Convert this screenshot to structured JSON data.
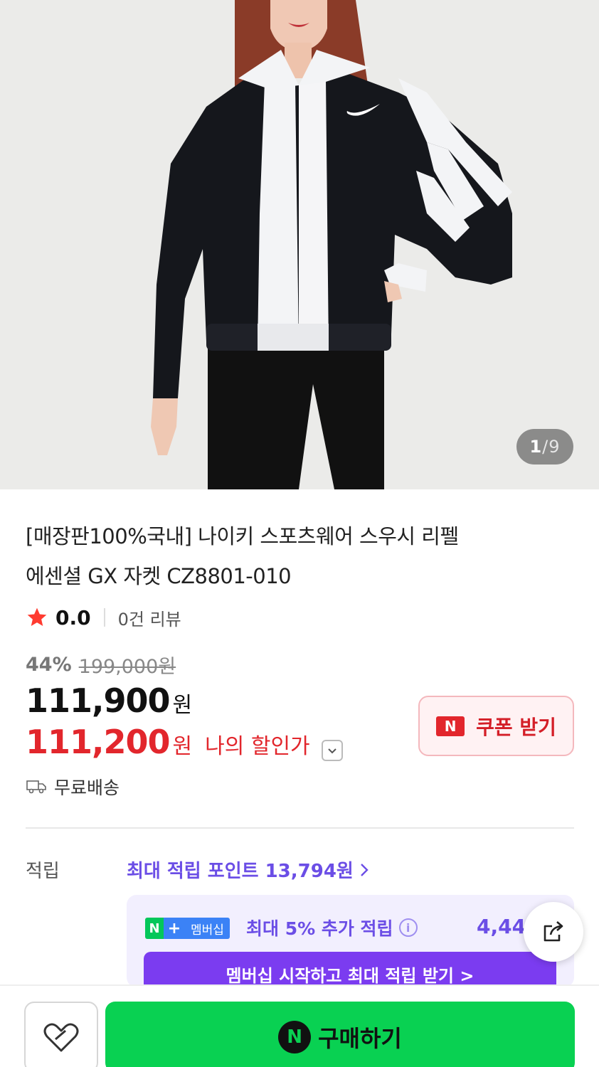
{
  "product_image": {
    "counter_current": "1",
    "counter_separator": "/",
    "counter_total": "9"
  },
  "product": {
    "title_line1": "[매장판100%국내] 나이키 스포츠웨어 스우시 리펠",
    "title_line2": "에센셜 GX 자켓 CZ8801-010"
  },
  "rating": {
    "score": "0.0",
    "review_count": "0건 리뷰"
  },
  "pricing": {
    "discount_rate": "44%",
    "original_price": "199,000원",
    "price": "111,900",
    "price_unit": "원",
    "my_price": "111,200",
    "my_price_unit": "원",
    "my_price_label": "나의 할인가"
  },
  "coupon": {
    "badge": "N",
    "label": "쿠폰 받기"
  },
  "shipping": {
    "label": "무료배송"
  },
  "points": {
    "label": "적립",
    "max_points_link": "최대 적립 포인트 13,794원"
  },
  "membership": {
    "badge_n": "N",
    "badge_plus": "+",
    "badge_text": "멤버십",
    "extra_text": "최대 5% 추가 적립",
    "amount": "4,44",
    "cta": "멤버십 시작하고 최대 적립 받기 >"
  },
  "bottom_bar": {
    "buy_badge": "N",
    "buy_label": "구매하기"
  },
  "colors": {
    "accent_red": "#e2262c",
    "accent_purple": "#6b4ee6",
    "buy_green": "#09d152",
    "membership_cta": "#7b3cf0"
  },
  "icons": {
    "star": "star-icon",
    "truck": "truck-icon",
    "chevron": "chevron-down-icon",
    "share": "share-icon",
    "heart": "heart-icon",
    "info": "info-icon"
  }
}
